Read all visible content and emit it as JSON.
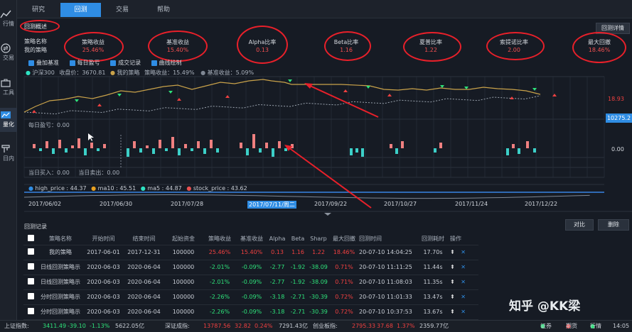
{
  "sidebar": {
    "items": [
      {
        "label": "行情",
        "icon": "chart-icon"
      },
      {
        "label": "交易",
        "icon": "swap-icon"
      },
      {
        "label": "工具",
        "icon": "toolbox-icon"
      },
      {
        "label": "量化",
        "icon": "quant-icon"
      },
      {
        "label": "日内",
        "icon": "intraday-icon"
      }
    ]
  },
  "tabs": [
    "研究",
    "回测",
    "交易",
    "帮助"
  ],
  "summary": {
    "title": "回测概述",
    "detail_button": "回测详情",
    "name_label": "策略名称",
    "name_value": "我的策略",
    "metrics": [
      {
        "label": "策略收益",
        "value": "25.46%"
      },
      {
        "label": "基准收益",
        "value": "15.40%"
      },
      {
        "label": "Alpha比率",
        "value": "0.13"
      },
      {
        "label": "Beta比率",
        "value": "1.16"
      },
      {
        "label": "夏普比率",
        "value": "1.22"
      },
      {
        "label": "索提诺比率",
        "value": "2.00"
      },
      {
        "label": "最大回撤",
        "value": "18.46%"
      }
    ]
  },
  "options": [
    "叠加基准",
    "每日盈亏",
    "成交记录",
    "曲线绘制"
  ],
  "main_legend": {
    "index": "沪深300",
    "close": "收盘价：3670.81",
    "mine": "我的策略",
    "strat": "策略收益：15.49%",
    "bench": "基准收益：5.09%"
  },
  "main_right": {
    "pct": "18.93",
    "price": "10275.2"
  },
  "daily_label": "每日盈亏：0.00",
  "daily_right": "0.00",
  "trade_label": {
    "buy": "当日买入：0.00",
    "sell": "当日卖出：0.00"
  },
  "nav_legend": [
    "high_price : 44.37",
    "ma10 : 45.51",
    "ma5 : 44.87",
    "stock_price : 43.62"
  ],
  "dates": [
    "2017/06/02",
    "2017/06/30",
    "2017/07/28",
    "2017/07/11/周二",
    "2017/09/22",
    "2017/10/27",
    "2017/11/24",
    "2017/12/22"
  ],
  "records": {
    "title": "回测记录",
    "compare_button": "对比",
    "delete_button": "删除",
    "headers": [
      "策略名称",
      "开始时间",
      "结束时间",
      "起始资金",
      "策略收益",
      "基准收益",
      "Alpha",
      "Beta",
      "Sharp",
      "最大回撤",
      "回测时间",
      "回测耗时",
      "操作"
    ],
    "rows": [
      {
        "name": "我的策略",
        "start": "2017-06-01",
        "end": "2017-12-31",
        "capital": "100000",
        "ret": "25.46%",
        "bench": "15.40%",
        "alpha": "0.13",
        "beta": "1.16",
        "sharp": "1.22",
        "dd": "18.46%",
        "time": "20-07-10 14:04:25",
        "cost": "17.70s"
      },
      {
        "name": "日线回测策略示",
        "start": "2020-06-03",
        "end": "2020-06-04",
        "capital": "100000",
        "ret": "-2.01%",
        "bench": "-0.09%",
        "alpha": "-2.77",
        "beta": "-1.92",
        "sharp": "-38.09",
        "dd": "0.71%",
        "time": "20-07-10 11:11:25",
        "cost": "11.44s"
      },
      {
        "name": "日线回测策略示",
        "start": "2020-06-03",
        "end": "2020-06-04",
        "capital": "100000",
        "ret": "-2.01%",
        "bench": "-0.09%",
        "alpha": "-2.77",
        "beta": "-1.92",
        "sharp": "-38.09",
        "dd": "0.71%",
        "time": "20-07-10 11:08:03",
        "cost": "11.35s"
      },
      {
        "name": "分时回测策略示",
        "start": "2020-06-03",
        "end": "2020-06-04",
        "capital": "100000",
        "ret": "-2.26%",
        "bench": "-0.09%",
        "alpha": "-3.18",
        "beta": "-2.71",
        "sharp": "-30.39",
        "dd": "0.72%",
        "time": "20-07-10 11:01:33",
        "cost": "13.47s"
      },
      {
        "name": "分时回测策略示",
        "start": "2020-06-03",
        "end": "2020-06-04",
        "capital": "100000",
        "ret": "-2.26%",
        "bench": "-0.09%",
        "alpha": "-3.18",
        "beta": "-2.71",
        "sharp": "-30.39",
        "dd": "0.72%",
        "time": "20-07-10 10:37:53",
        "cost": "13.67s"
      }
    ]
  },
  "status": {
    "sh_label": "上证指数:",
    "sh_value": "3411.49",
    "sh_change": "-39.10",
    "sh_pct": "-1.13%",
    "sh_vol": "5622.05亿",
    "sz_label": "深证成指:",
    "sz_value": "13787.56",
    "sz_change": "32.82",
    "sz_pct": "0.24%",
    "sz_vol": "7291.43亿",
    "cy_label": "创业板指:",
    "cy_value": "2795.33",
    "cy_change": "37.68",
    "cy_pct": "1.37%",
    "cy_vol": "2359.77亿",
    "links": [
      "证券",
      "期货",
      "行情"
    ],
    "time": "14:05"
  },
  "watermark": "知乎 @KK梁",
  "colors": {
    "accent": "#2f8de4",
    "up": "#ef4040",
    "down": "#2ee27a",
    "annotation": "#e8202a",
    "strategy_line": "#c9a24a"
  }
}
